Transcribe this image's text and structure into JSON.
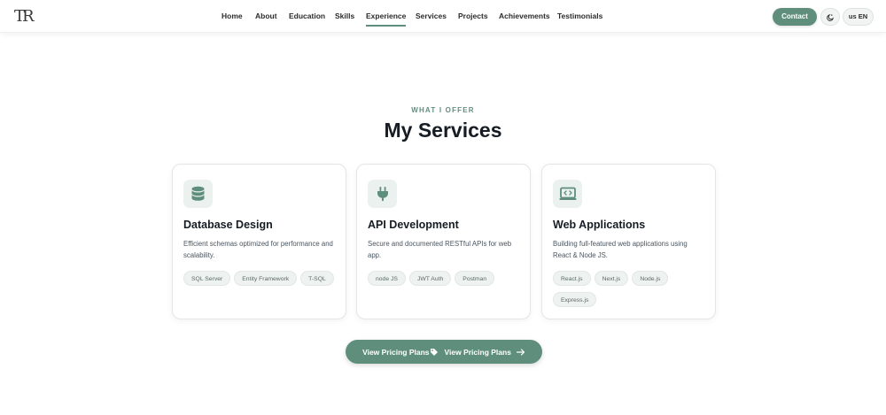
{
  "brand": {
    "logo_text": "TR"
  },
  "nav": {
    "items": [
      {
        "label": "Home"
      },
      {
        "label": "About"
      },
      {
        "label": "Education"
      },
      {
        "label": "Skills"
      },
      {
        "label": "Experience",
        "active": true
      },
      {
        "label": "Services"
      },
      {
        "label": "Projects"
      },
      {
        "label": "Achievements"
      },
      {
        "label": "Testimonials"
      }
    ],
    "contact_label": "Contact",
    "theme_icon": "theme-toggle-icon",
    "language_label": "us EN"
  },
  "section": {
    "eyebrow": "WHAT I OFFER",
    "title": "My Services"
  },
  "cards": [
    {
      "icon": "database-icon",
      "title": "Database Design",
      "description": "Efficient schemas optimized for performance and scalability.",
      "tags": [
        "SQL Server",
        "Entity Framework",
        "T-SQL"
      ]
    },
    {
      "icon": "plug-icon",
      "title": "API Development",
      "description": "Secure and documented RESTful APIs for web app.",
      "tags": [
        "node JS",
        "JWT Auth",
        "Postman"
      ]
    },
    {
      "icon": "code-window-icon",
      "title": "Web Applications",
      "description": "Building full-featured web applications using React & Node JS.",
      "tags": [
        "React.js",
        "Next.js",
        "Node.js",
        "Express.js"
      ]
    }
  ],
  "cta": {
    "label_a": "View Pricing Plans",
    "label_b": "View Pricing Plans"
  },
  "colors": {
    "accent": "#5f8f7c",
    "icon_bg": "#eaf1ee",
    "tag_bg": "#eef2f0"
  }
}
